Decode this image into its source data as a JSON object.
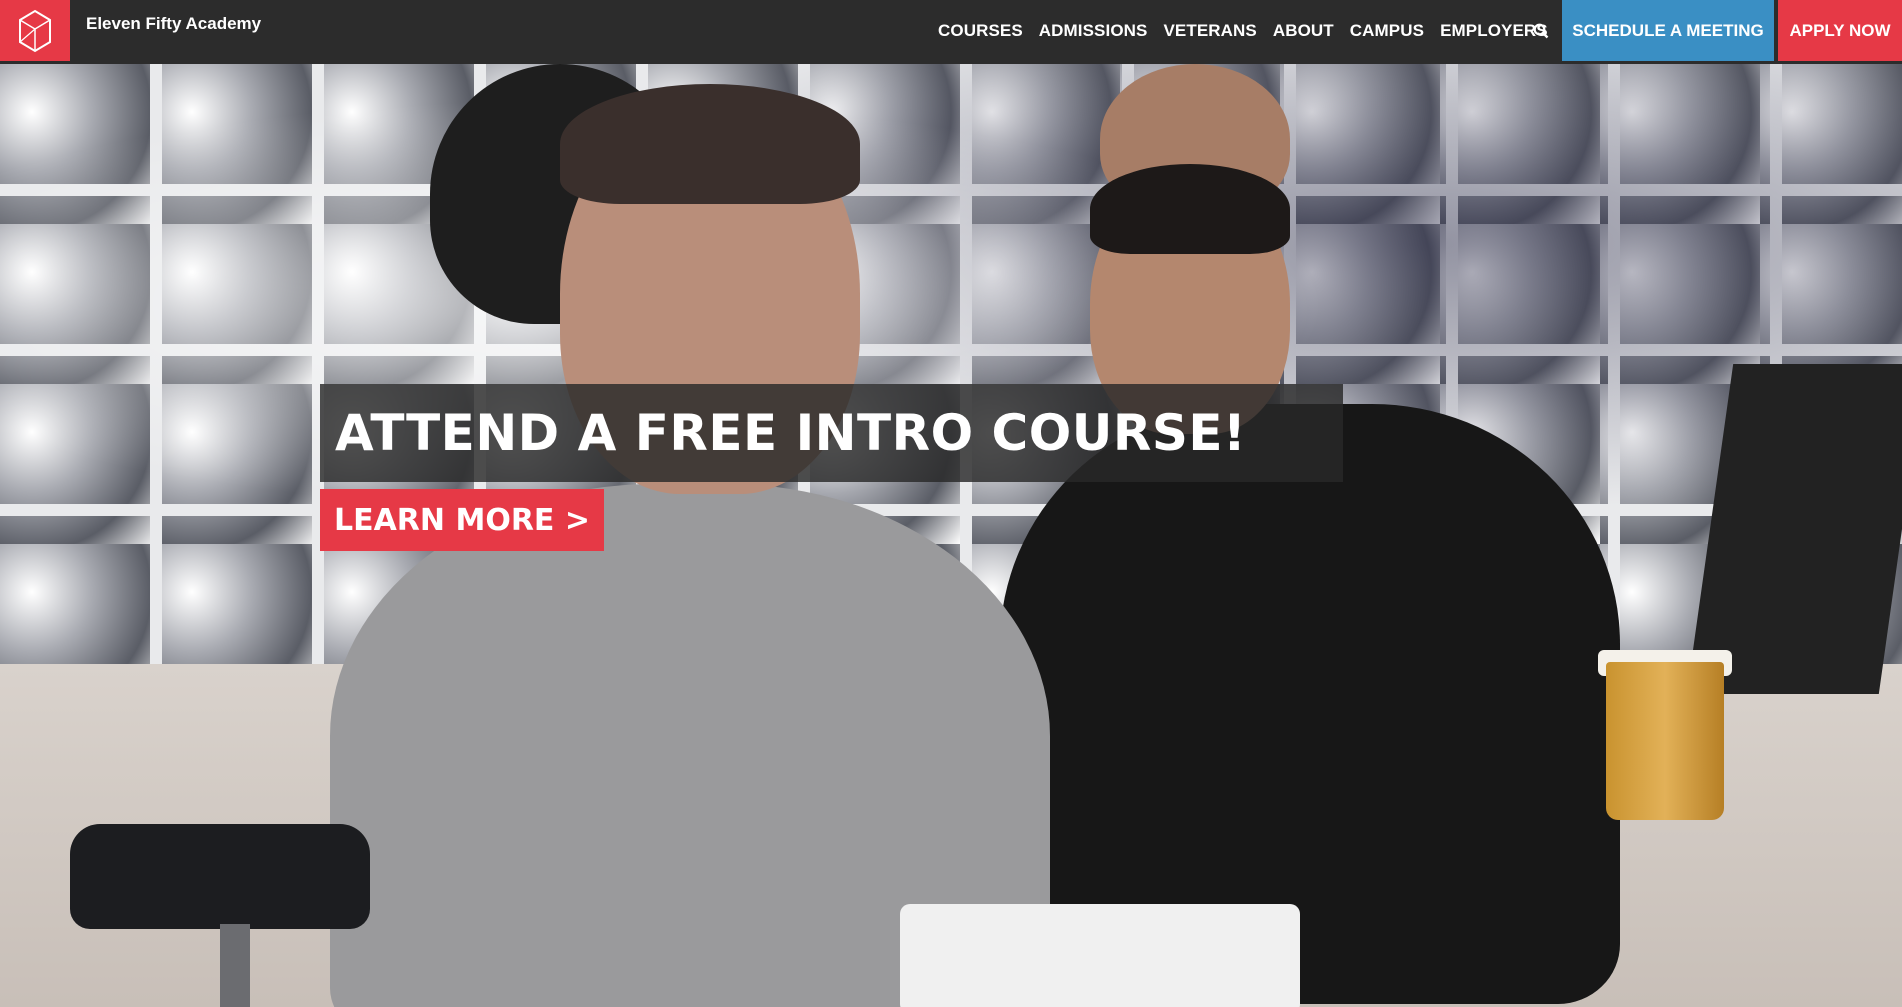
{
  "brand": {
    "name": "Eleven Fifty Academy",
    "logo_icon": "geometric-logo-icon",
    "accent_color": "#e63946"
  },
  "nav": {
    "items": [
      "COURSES",
      "ADMISSIONS",
      "VETERANS",
      "ABOUT",
      "CAMPUS",
      "EMPLOYERS"
    ],
    "search_icon": "search-icon",
    "schedule_label": "SCHEDULE A MEETING",
    "schedule_color": "#3a8fc4",
    "apply_label": "APPLY NOW",
    "apply_color": "#e63946"
  },
  "hero": {
    "headline": "ATTEND A FREE INTRO COURSE!",
    "cta_label": "LEARN MORE >"
  }
}
